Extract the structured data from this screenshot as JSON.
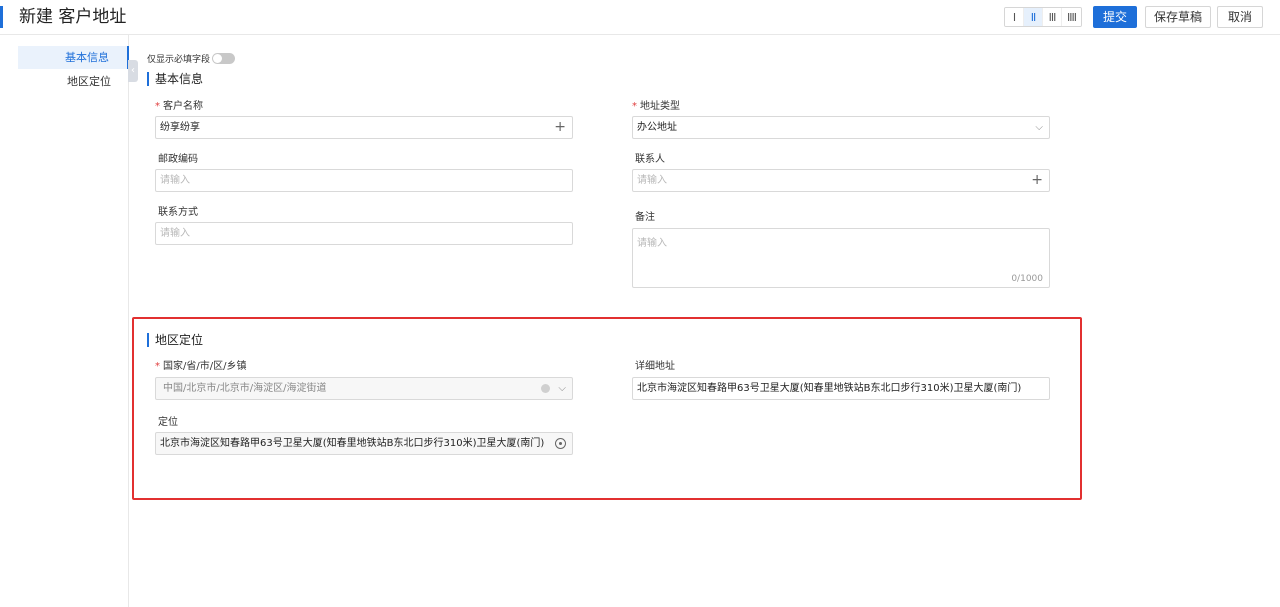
{
  "header": {
    "title": "新建 客户地址",
    "layout_options": [
      "I",
      "II",
      "III",
      "IIII"
    ],
    "submit_label": "提交",
    "save_draft_label": "保存草稿",
    "cancel_label": "取消"
  },
  "sidebar": {
    "items": [
      {
        "label": "基本信息",
        "active": true
      },
      {
        "label": "地区定位",
        "active": false
      }
    ],
    "collapse_glyph": "‹"
  },
  "main": {
    "required_only_label": "仅显示必填字段",
    "basic_section": {
      "title": "基本信息",
      "customer_name": {
        "label": "客户名称",
        "value": "纷享纷享",
        "suffix": "+"
      },
      "address_type": {
        "label": "地址类型",
        "value": "办公地址",
        "suffix": "⌵"
      },
      "postal_code": {
        "label": "邮政编码",
        "placeholder": "请输入"
      },
      "contact": {
        "label": "联系人",
        "placeholder": "请输入",
        "suffix": "+"
      },
      "contact_method": {
        "label": "联系方式",
        "placeholder": "请输入"
      },
      "remark": {
        "label": "备注",
        "placeholder": "请输入",
        "counter": "0/1000"
      }
    },
    "location_section": {
      "title": "地区定位",
      "region": {
        "label": "国家/省/市/区/乡镇",
        "value": "中国/北京市/北京市/海淀区/海淀街道",
        "suffix": "⌵"
      },
      "detail_address": {
        "label": "详细地址",
        "value": "北京市海淀区知春路甲63号卫星大厦(知春里地铁站B东北口步行310米)卫星大厦(南门)"
      },
      "positioning": {
        "label": "定位",
        "value": "北京市海淀区知春路甲63号卫星大厦(知春里地铁站B东北口步行310米)卫星大厦(南门)"
      }
    }
  },
  "colors": {
    "accent": "#1e6fd9",
    "required": "#e03c3c",
    "highlight": "#e23030"
  }
}
